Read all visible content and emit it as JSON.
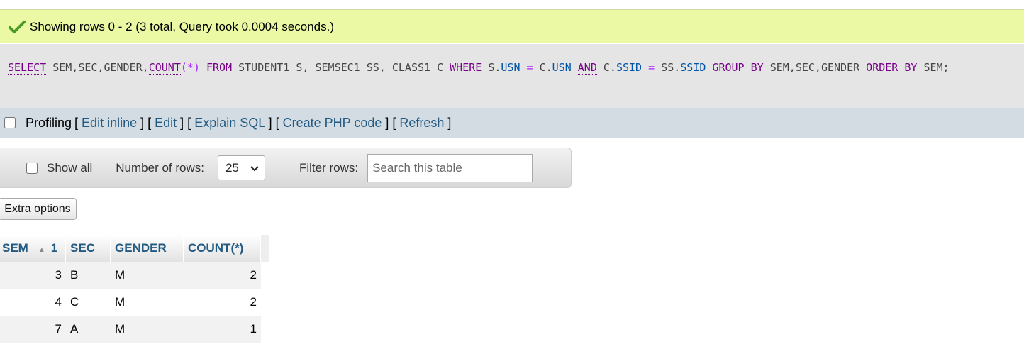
{
  "status": {
    "message": "Showing rows 0 - 2 (3 total, Query took 0.0004 seconds.)",
    "icon": "check-icon",
    "color": "#ebf8a4"
  },
  "sql": {
    "tokens": [
      {
        "t": "SELECT",
        "c": "kw-u"
      },
      {
        "t": " SEM,SEC,GENDER,",
        "c": "plain"
      },
      {
        "t": "COUNT",
        "c": "kw-u"
      },
      {
        "t": "(*)",
        "c": "op"
      },
      {
        "t": " ",
        "c": "plain"
      },
      {
        "t": "FROM",
        "c": "kw"
      },
      {
        "t": " STUDENT1 S, SEMSEC1 SS, CLASS1 C ",
        "c": "plain"
      },
      {
        "t": "WHERE",
        "c": "kw"
      },
      {
        "t": " S.",
        "c": "plain"
      },
      {
        "t": "USN",
        "c": "var"
      },
      {
        "t": " = ",
        "c": "op"
      },
      {
        "t": "C.",
        "c": "plain"
      },
      {
        "t": "USN",
        "c": "var"
      },
      {
        "t": " ",
        "c": "plain"
      },
      {
        "t": "AND",
        "c": "kw-u"
      },
      {
        "t": " C.",
        "c": "plain"
      },
      {
        "t": "SSID",
        "c": "var"
      },
      {
        "t": " = ",
        "c": "op"
      },
      {
        "t": "SS.",
        "c": "plain"
      },
      {
        "t": "SSID",
        "c": "var"
      },
      {
        "t": " ",
        "c": "plain"
      },
      {
        "t": "GROUP BY",
        "c": "kw"
      },
      {
        "t": " SEM,SEC,GENDER ",
        "c": "plain"
      },
      {
        "t": "ORDER BY",
        "c": "kw"
      },
      {
        "t": " SEM;",
        "c": "plain"
      }
    ]
  },
  "profiling": {
    "label": "Profiling",
    "open": "[",
    "close": "]",
    "links": [
      "Edit inline",
      "Edit",
      "Explain SQL",
      "Create PHP code",
      "Refresh"
    ]
  },
  "navigation": {
    "show_all_label": "Show all",
    "rows_label": "Number of rows:",
    "rows_value": "25",
    "filter_label": "Filter rows:",
    "filter_placeholder": "Search this table"
  },
  "extra_options_label": "Extra options",
  "table": {
    "columns": [
      {
        "label": "SEM",
        "sort_order": "1",
        "sort_icon": "sort-ascending-icon"
      },
      {
        "label": "SEC"
      },
      {
        "label": "GENDER"
      },
      {
        "label": "COUNT(*)"
      }
    ],
    "rows": [
      {
        "sem": "3",
        "sec": "B",
        "gender": "M",
        "count": "2"
      },
      {
        "sem": "4",
        "sec": "C",
        "gender": "M",
        "count": "2"
      },
      {
        "sem": "7",
        "sec": "A",
        "gender": "M",
        "count": "1"
      }
    ]
  }
}
